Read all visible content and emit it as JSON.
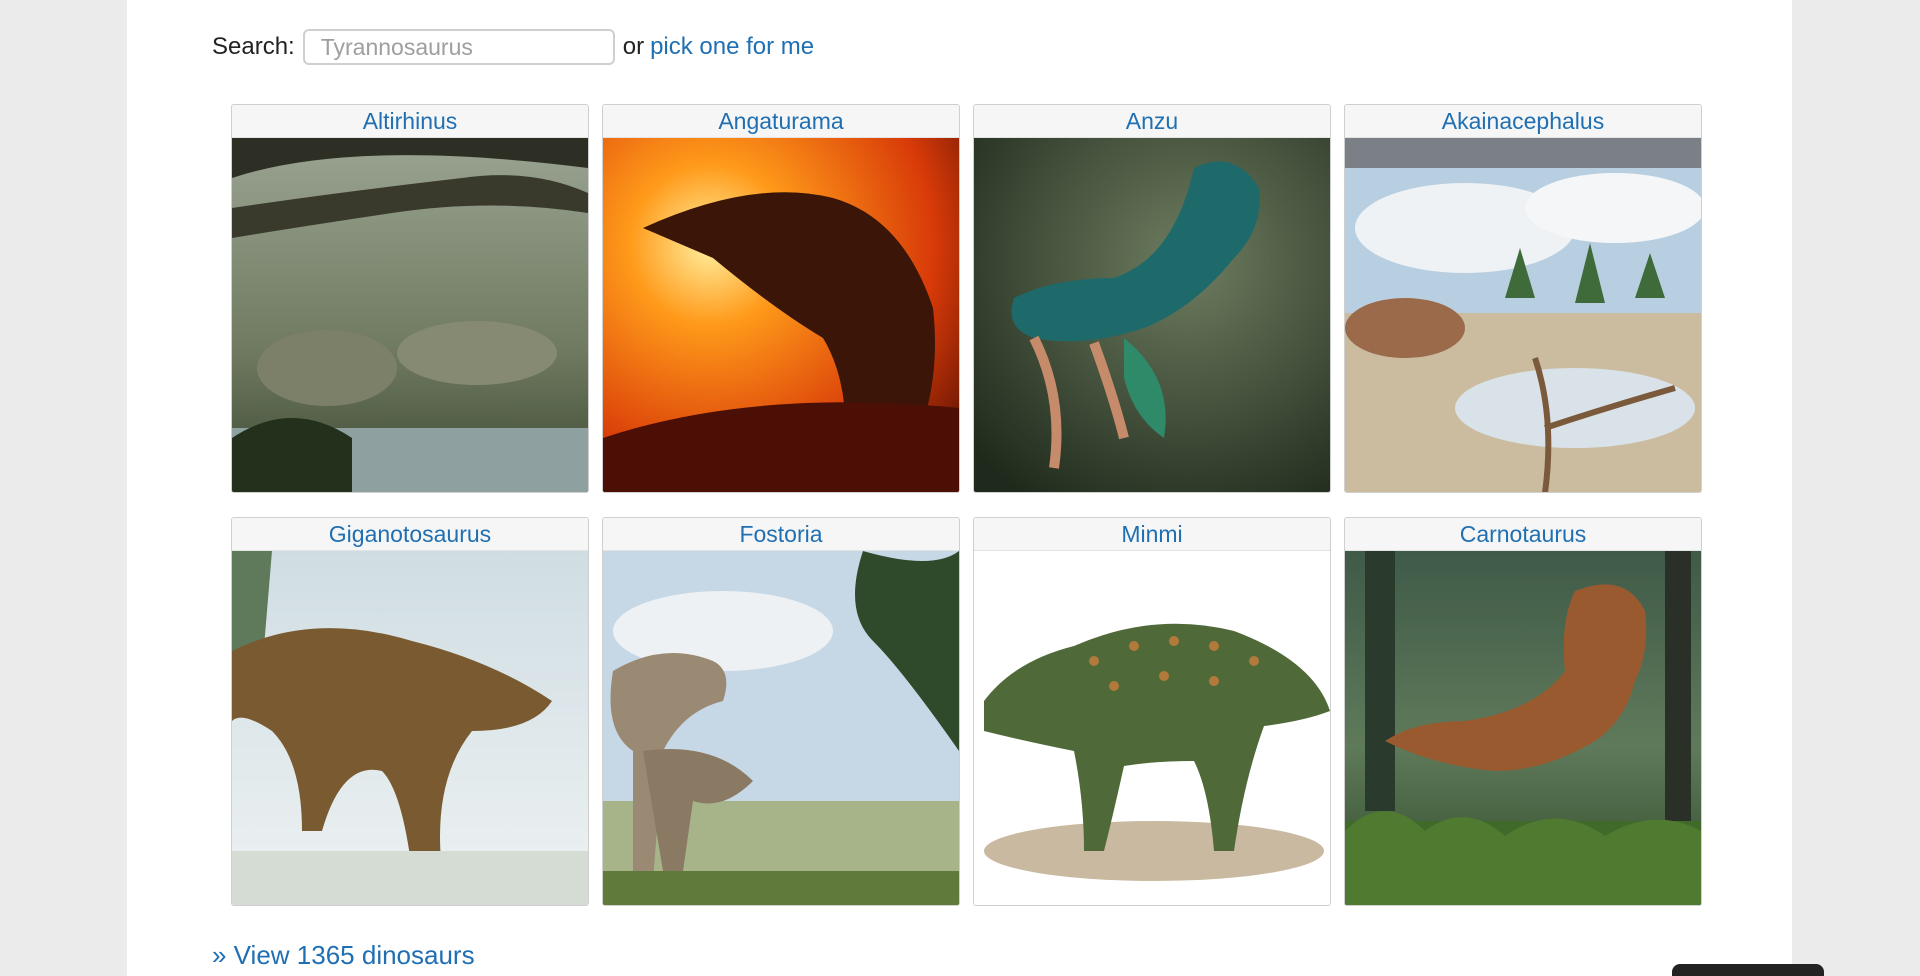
{
  "search": {
    "label": "Search:",
    "placeholder": "Tyrannosaurus",
    "or_text": "or",
    "pick_link": "pick one for me"
  },
  "cards": [
    {
      "name": "Altirhinus",
      "image": "dinosaur-illustration"
    },
    {
      "name": "Angaturama",
      "image": "dinosaur-illustration"
    },
    {
      "name": "Anzu",
      "image": "dinosaur-illustration"
    },
    {
      "name": "Akainacephalus",
      "image": "dinosaur-illustration"
    },
    {
      "name": "Giganotosaurus",
      "image": "dinosaur-illustration"
    },
    {
      "name": "Fostoria",
      "image": "dinosaur-illustration"
    },
    {
      "name": "Minmi",
      "image": "dinosaur-illustration"
    },
    {
      "name": "Carnotaurus",
      "image": "dinosaur-illustration"
    }
  ],
  "footer": {
    "view_all": "» View 1365 dinosaurs"
  },
  "colors": {
    "link": "#1f6fb2",
    "background": "#ebebeb"
  }
}
